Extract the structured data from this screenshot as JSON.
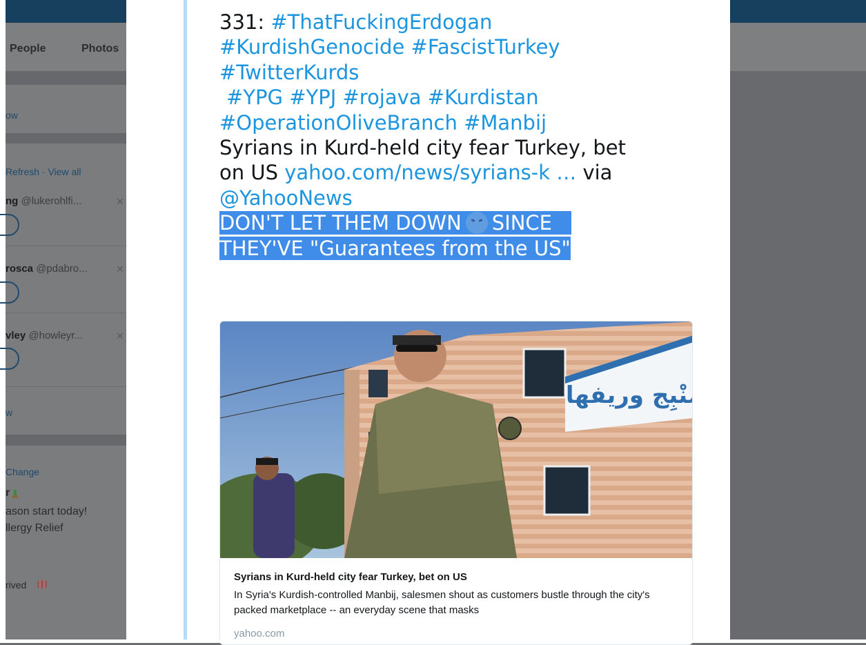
{
  "background": {
    "nav_tabs": [
      "People",
      "Photos"
    ],
    "who_to_follow": {
      "link_top": "ow",
      "refresh_label": "Refresh · View all",
      "suggestions": [
        {
          "name": "ng",
          "handle": "@lukerohlfi..."
        },
        {
          "name": "rosca",
          "handle": "@pdabro..."
        },
        {
          "name": "vley",
          "handle": "@howleyr..."
        }
      ],
      "link_bottom": "w"
    },
    "trends": {
      "change_label": "Change",
      "items": [
        "r",
        "ason start today!",
        "llergy Relief",
        "rived"
      ]
    }
  },
  "tweet": {
    "text_prefix": "331: ",
    "hashtags_1": [
      "#ThatFuckingErdogan"
    ],
    "hashtags_2": [
      "#KurdishGenocide",
      "#FascistTurkey"
    ],
    "hashtags_3": [
      "#TwitterKurds"
    ],
    "hashtags_4": [
      "#YPG",
      "#YPJ",
      "#rojava",
      "#Kurdistan"
    ],
    "hashtags_5": [
      "#OperationOliveBranch",
      "#Manbij"
    ],
    "body_line_1": "Syrians in Kurd-held city fear Turkey, bet",
    "body_line_2_start": "on US ",
    "link_text": "yahoo.com/news/syrians-k",
    "ellipsis": "  …",
    "via": " via",
    "mention": "@YahooNews",
    "highlight_part_1": "DON'T LET THEM DOWN",
    "highlight_part_2": "SINCE",
    "highlight_line_2": "THEY'VE \"Guarantees from the US\"",
    "colors": {
      "link": "#1b95e0",
      "highlight": "#3f8de8",
      "thread": "#b7dcf6"
    }
  },
  "card": {
    "sign_text": "مَنْبِج وريفها",
    "title": "Syrians in Kurd-held city fear Turkey, bet on US",
    "description": "In Syria's Kurdish-controlled Manbij, salesmen shout as customers bustle through the city's packed marketplace -- an everyday scene that masks",
    "domain": "yahoo.com"
  }
}
